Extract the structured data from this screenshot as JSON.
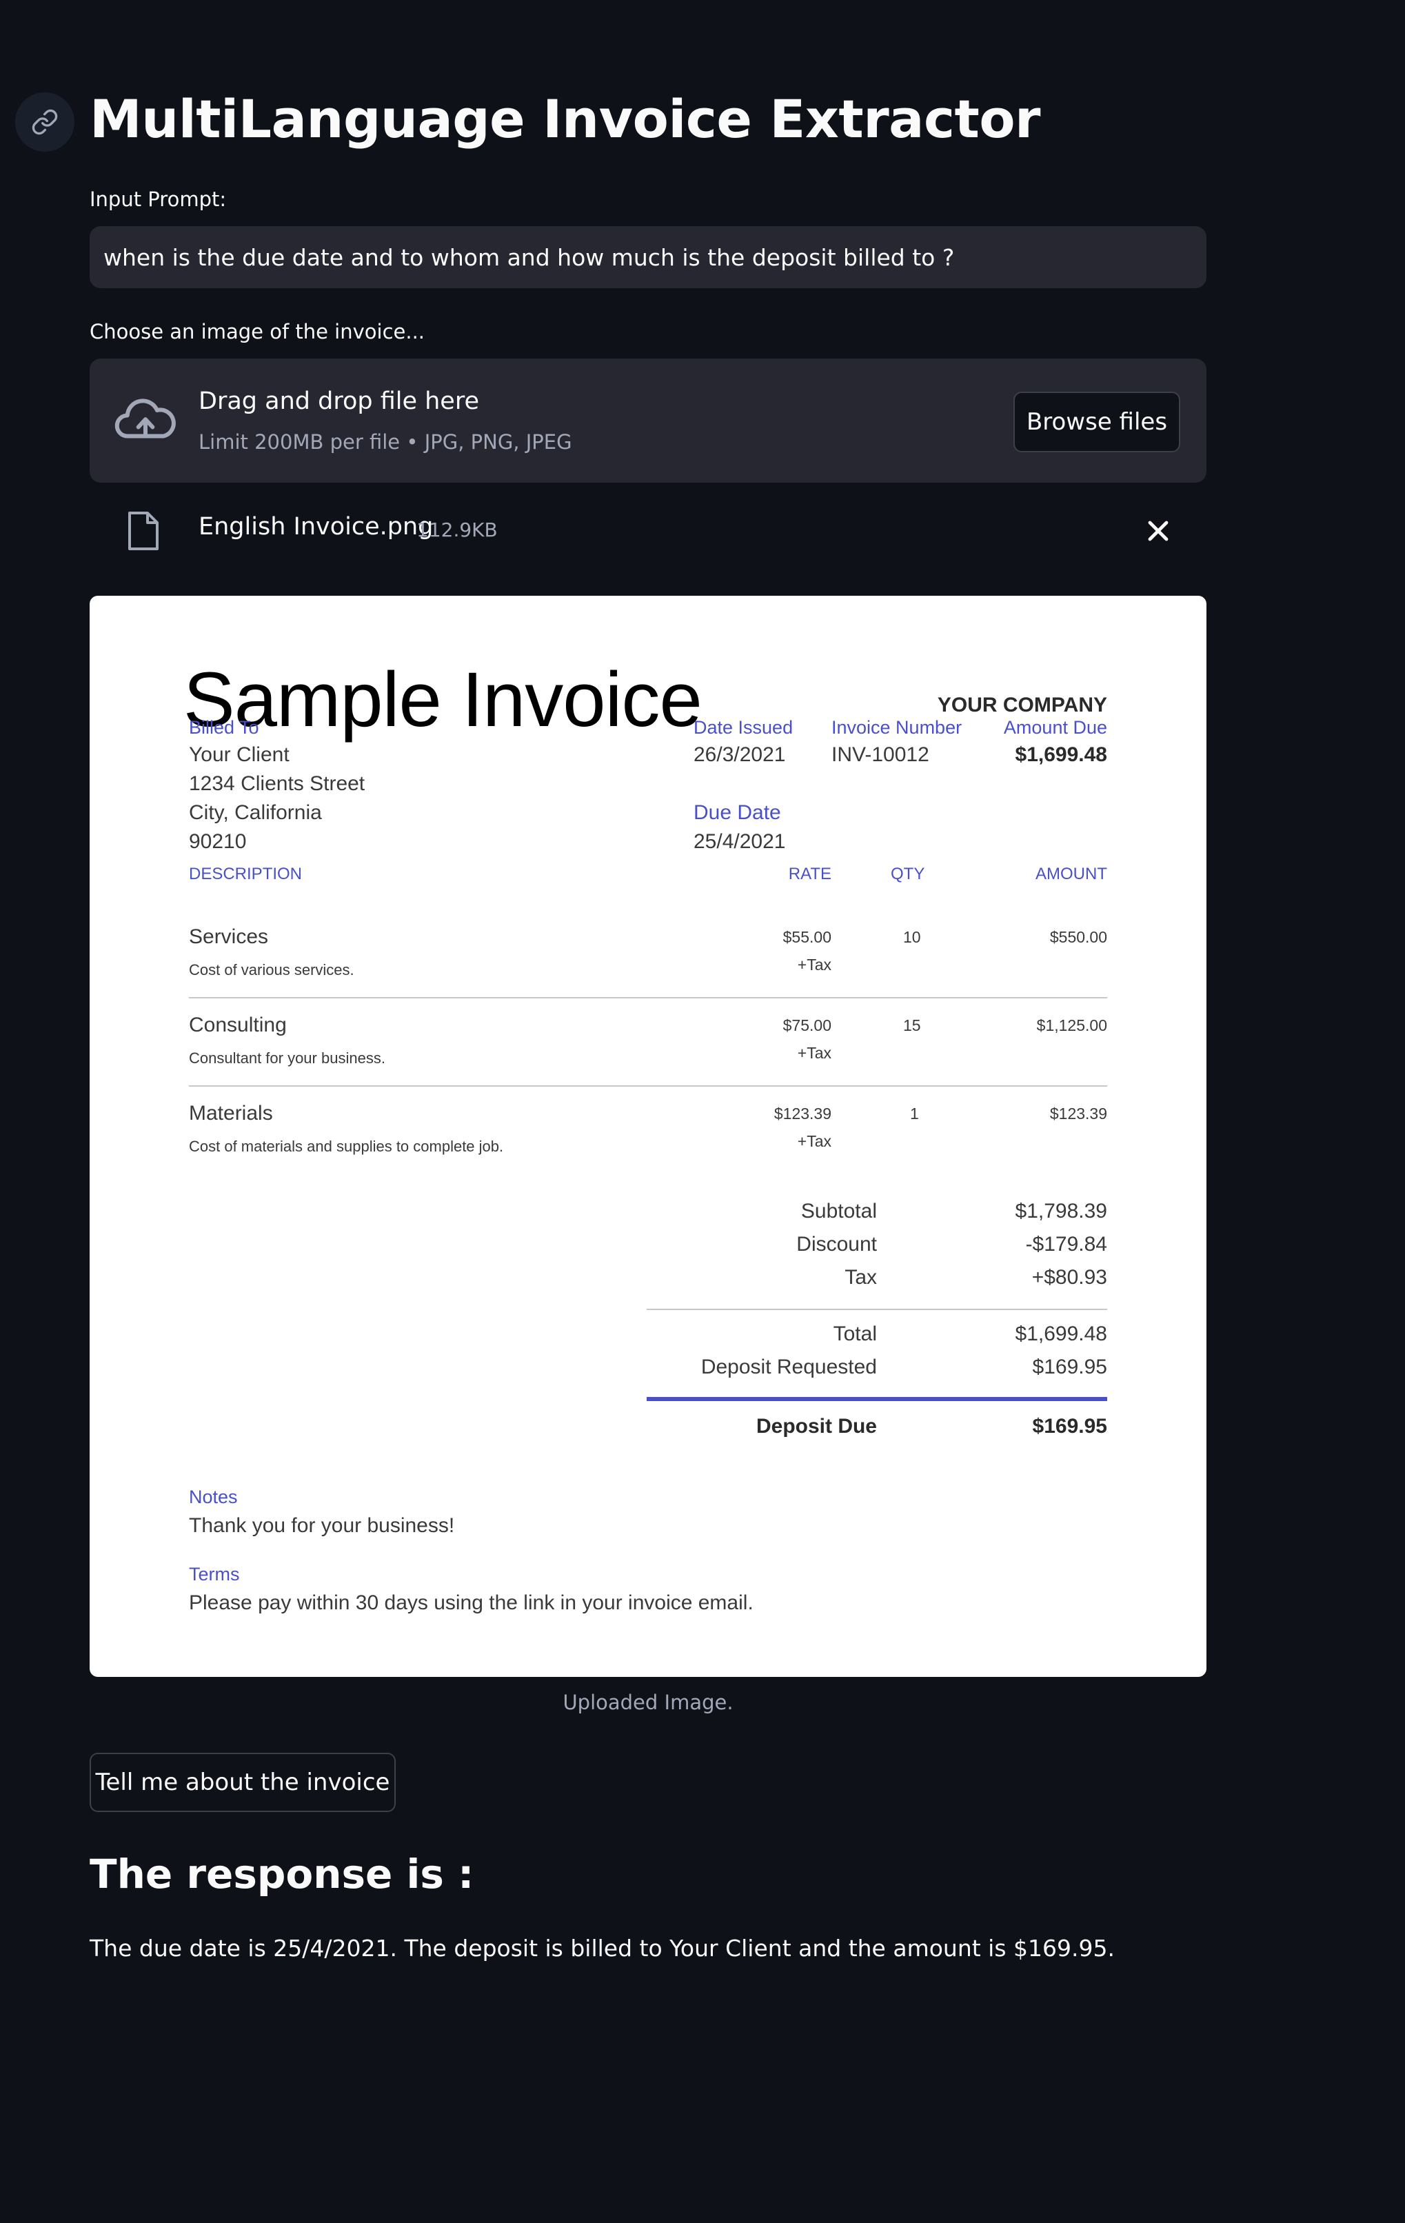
{
  "header": {
    "title": "MultiLanguage Invoice Extractor",
    "anchor_icon": "link-icon"
  },
  "prompt": {
    "label": "Input Prompt:",
    "value": "when is the due date and to whom and how much is the deposit billed to ?"
  },
  "uploader": {
    "label": "Choose an image of the invoice...",
    "drop_title": "Drag and drop file here",
    "drop_limit": "Limit 200MB per file • JPG, PNG, JPEG",
    "browse_label": "Browse files",
    "icon": "cloud-upload-icon",
    "file": {
      "name": "English Invoice.png",
      "size": "112.9KB",
      "icon": "file-icon"
    }
  },
  "invoice": {
    "title": "Sample Invoice",
    "company": "YOUR COMPANY",
    "billed_to_label": "Billed To",
    "client_lines": [
      "Your Client",
      "1234 Clients Street",
      "City, California",
      "90210"
    ],
    "date_issued_label": "Date Issued",
    "date_issued": "26/3/2021",
    "invoice_number_label": "Invoice Number",
    "invoice_number": "INV-10012",
    "amount_due_label": "Amount Due",
    "amount_due": "$1,699.48",
    "due_date_label": "Due Date",
    "due_date": "25/4/2021",
    "columns": {
      "description": "DESCRIPTION",
      "rate": "RATE",
      "qty": "QTY",
      "amount": "AMOUNT"
    },
    "items": [
      {
        "name": "Services",
        "desc": "Cost of various services.",
        "rate": "$55.00",
        "tax": "+Tax",
        "qty": "10",
        "amount": "$550.00"
      },
      {
        "name": "Consulting",
        "desc": "Consultant for your business.",
        "rate": "$75.00",
        "tax": "+Tax",
        "qty": "15",
        "amount": "$1,125.00"
      },
      {
        "name": "Materials",
        "desc": "Cost of materials and supplies to complete job.",
        "rate": "$123.39",
        "tax": "+Tax",
        "qty": "1",
        "amount": "$123.39"
      }
    ],
    "totals": {
      "subtotal_label": "Subtotal",
      "subtotal": "$1,798.39",
      "discount_label": "Discount",
      "discount": "-$179.84",
      "tax_label": "Tax",
      "tax": "+$80.93",
      "total_label": "Total",
      "total": "$1,699.48",
      "deposit_requested_label": "Deposit Requested",
      "deposit_requested": "$169.95",
      "deposit_due_label": "Deposit Due",
      "deposit_due": "$169.95"
    },
    "notes_label": "Notes",
    "notes": "Thank you for your business!",
    "terms_label": "Terms",
    "terms": "Please pay within 30 days using the link in your invoice email."
  },
  "caption": "Uploaded Image.",
  "action_button": "Tell me about the invoice",
  "response": {
    "heading": "The response is :",
    "text": "The due date is 25/4/2021. The deposit is billed to Your Client and the amount is $169.95."
  },
  "colors": {
    "background": "#0e1117",
    "widget": "#262730",
    "muted_text": "#a3a8b8",
    "invoice_accent": "#4a50c8"
  }
}
